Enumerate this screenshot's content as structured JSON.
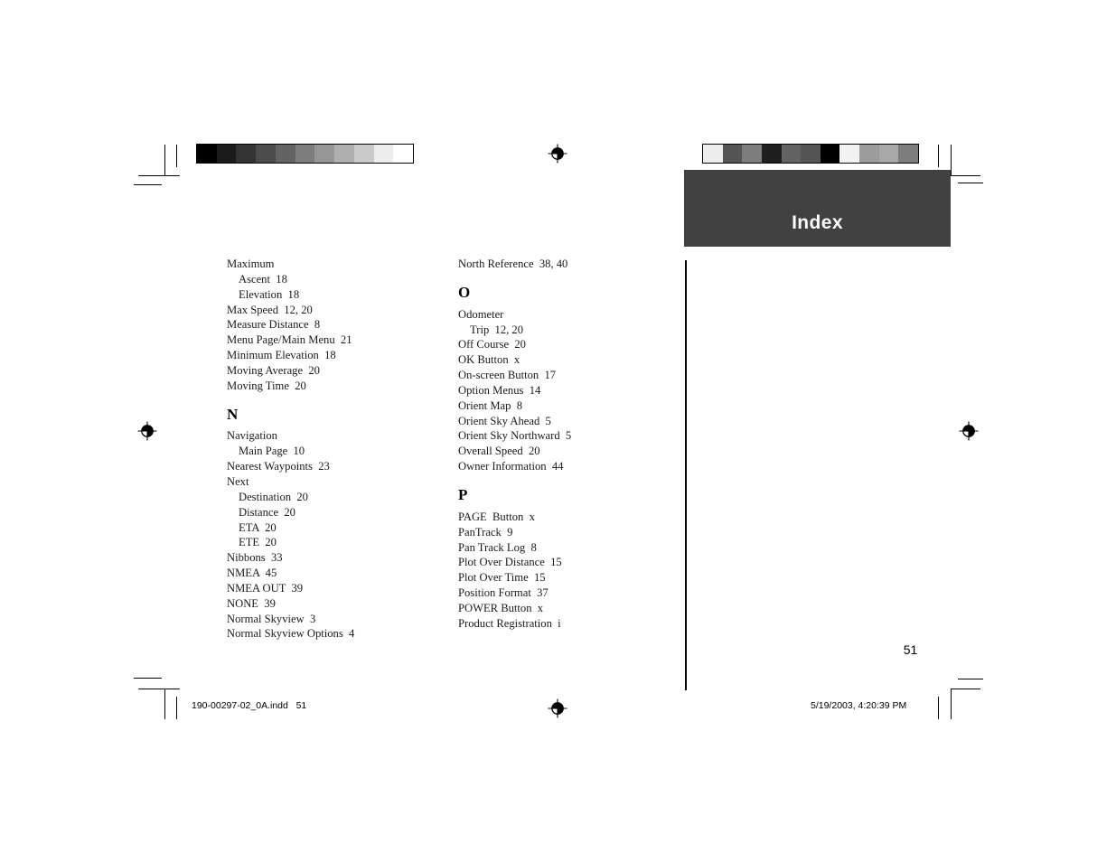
{
  "page": {
    "banner_title": "Index",
    "folio": "51",
    "accent_color": "#414141"
  },
  "footer": {
    "file_slug": "190-00297-02_0A.indd   51",
    "timestamp_slug": "5/19/2003, 4:20:39 PM"
  },
  "colorbars": {
    "left": [
      "#000000",
      "#1b1b1b",
      "#333333",
      "#4b4b4b",
      "#636363",
      "#7d7d7d",
      "#969696",
      "#b0b0b0",
      "#cacaca",
      "#ededed",
      "#ffffff"
    ],
    "right": [
      "#ededed",
      "#545454",
      "#7d7d7d",
      "#1f1f1f",
      "#636363",
      "#545454",
      "#000000",
      "#f2f2f2",
      "#9c9c9c",
      "#a8a8a8",
      "#7d7d7d"
    ]
  },
  "columns": {
    "left": [
      {
        "kind": "entry",
        "level": 0,
        "text": "Maximum"
      },
      {
        "kind": "entry",
        "level": 1,
        "text": "Ascent  18"
      },
      {
        "kind": "entry",
        "level": 1,
        "text": "Elevation  18"
      },
      {
        "kind": "entry",
        "level": 0,
        "text": "Max Speed  12, 20"
      },
      {
        "kind": "entry",
        "level": 0,
        "text": "Measure Distance  8"
      },
      {
        "kind": "entry",
        "level": 0,
        "text": "Menu Page/Main Menu  21"
      },
      {
        "kind": "entry",
        "level": 0,
        "text": "Minimum Elevation  18"
      },
      {
        "kind": "entry",
        "level": 0,
        "text": "Moving Average  20"
      },
      {
        "kind": "entry",
        "level": 0,
        "text": "Moving Time  20"
      },
      {
        "kind": "letter",
        "text": "N"
      },
      {
        "kind": "entry",
        "level": 0,
        "text": "Navigation"
      },
      {
        "kind": "entry",
        "level": 1,
        "text": "Main Page  10"
      },
      {
        "kind": "entry",
        "level": 0,
        "text": "Nearest Waypoints  23"
      },
      {
        "kind": "entry",
        "level": 0,
        "text": "Next"
      },
      {
        "kind": "entry",
        "level": 1,
        "text": "Destination  20"
      },
      {
        "kind": "entry",
        "level": 1,
        "text": "Distance  20"
      },
      {
        "kind": "entry",
        "level": 1,
        "text": "ETA  20"
      },
      {
        "kind": "entry",
        "level": 1,
        "text": "ETE  20"
      },
      {
        "kind": "entry",
        "level": 0,
        "text": "Nibbons  33"
      },
      {
        "kind": "entry",
        "level": 0,
        "text": "NMEA  45"
      },
      {
        "kind": "entry",
        "level": 0,
        "text": "NMEA OUT  39"
      },
      {
        "kind": "entry",
        "level": 0,
        "text": "NONE  39"
      },
      {
        "kind": "entry",
        "level": 0,
        "text": "Normal Skyview  3"
      },
      {
        "kind": "entry",
        "level": 0,
        "text": "Normal Skyview Options  4"
      }
    ],
    "right": [
      {
        "kind": "entry",
        "level": 0,
        "text": "North Reference  38, 40"
      },
      {
        "kind": "letter",
        "text": "O"
      },
      {
        "kind": "entry",
        "level": 0,
        "text": "Odometer"
      },
      {
        "kind": "entry",
        "level": 1,
        "text": "Trip  12, 20"
      },
      {
        "kind": "entry",
        "level": 0,
        "text": "Off Course  20"
      },
      {
        "kind": "entry",
        "level": 0,
        "text": "OK Button  x"
      },
      {
        "kind": "entry",
        "level": 0,
        "text": "On-screen Button  17"
      },
      {
        "kind": "entry",
        "level": 0,
        "text": "Option Menus  14"
      },
      {
        "kind": "entry",
        "level": 0,
        "text": "Orient Map  8"
      },
      {
        "kind": "entry",
        "level": 0,
        "text": "Orient Sky Ahead  5"
      },
      {
        "kind": "entry",
        "level": 0,
        "text": "Orient Sky Northward  5"
      },
      {
        "kind": "entry",
        "level": 0,
        "text": "Overall Speed  20"
      },
      {
        "kind": "entry",
        "level": 0,
        "text": "Owner Information  44"
      },
      {
        "kind": "letter",
        "text": "P"
      },
      {
        "kind": "entry",
        "level": 0,
        "text": "PAGE  Button  x"
      },
      {
        "kind": "entry",
        "level": 0,
        "text": "PanTrack  9"
      },
      {
        "kind": "entry",
        "level": 0,
        "text": "Pan Track Log  8"
      },
      {
        "kind": "entry",
        "level": 0,
        "text": "Plot Over Distance  15"
      },
      {
        "kind": "entry",
        "level": 0,
        "text": "Plot Over Time  15"
      },
      {
        "kind": "entry",
        "level": 0,
        "text": "Position Format  37"
      },
      {
        "kind": "entry",
        "level": 0,
        "text": "POWER Button  x"
      },
      {
        "kind": "entry",
        "level": 0,
        "text": "Product Registration  i"
      }
    ]
  },
  "printer_marks": {
    "registration_icon": "registration-target-icon",
    "crop_icon": "crop-mark"
  }
}
